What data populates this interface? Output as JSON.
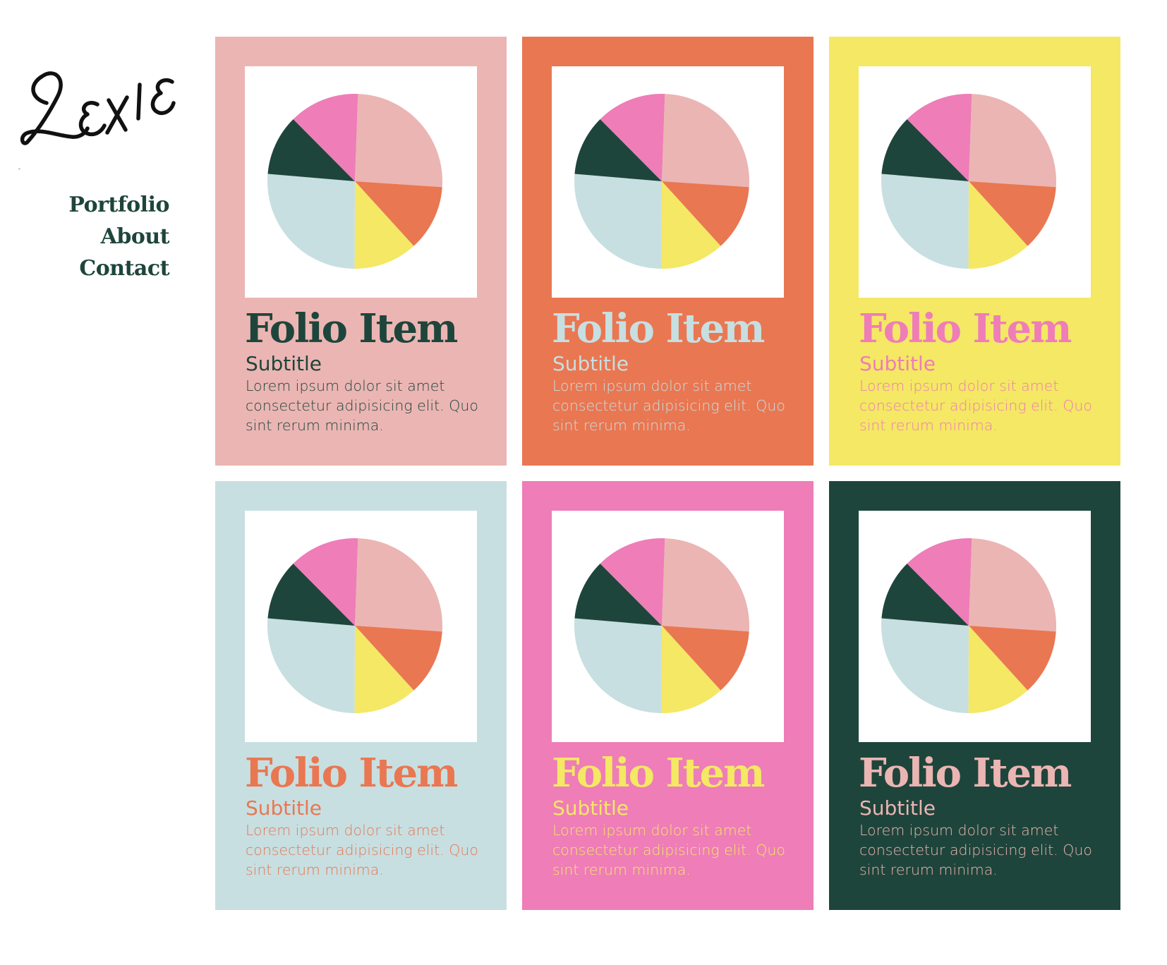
{
  "brand": {
    "logo_text": "Lexie"
  },
  "nav": {
    "items": [
      {
        "label": "Portfolio"
      },
      {
        "label": "About"
      },
      {
        "label": "Contact"
      }
    ]
  },
  "palette": {
    "pink_light": "#EBB5B3",
    "orange": "#E97752",
    "yellow": "#F4E864",
    "light_blue": "#C7DFE1",
    "pink": "#EE7DB8",
    "dark_green": "#1E453B"
  },
  "pie_slices": [
    {
      "color": "#EBB5B3",
      "percent": 25.5
    },
    {
      "color": "#E97752",
      "percent": 12.2
    },
    {
      "color": "#F4E864",
      "percent": 11.8
    },
    {
      "color": "#C7DFE1",
      "percent": 26.3
    },
    {
      "color": "#1E453B",
      "percent": 11.2
    },
    {
      "color": "#EE7DB8",
      "percent": 13.0
    }
  ],
  "cards": [
    {
      "title": "Folio Item",
      "subtitle": "Subtitle",
      "body": "Lorem ipsum dolor sit amet consectetur adipisicing elit. Quo sint rerum minima.",
      "bg": "#EBB5B3",
      "text": "#1E453B"
    },
    {
      "title": "Folio Item",
      "subtitle": "Subtitle",
      "body": "Lorem ipsum dolor sit amet consectetur adipisicing elit. Quo sint rerum minima.",
      "bg": "#E97752",
      "text": "#C7DFE1"
    },
    {
      "title": "Folio Item",
      "subtitle": "Subtitle",
      "body": "Lorem ipsum dolor sit amet consectetur adipisicing elit. Quo sint rerum minima.",
      "bg": "#F4E864",
      "text": "#EE7DB8"
    },
    {
      "title": "Folio Item",
      "subtitle": "Subtitle",
      "body": "Lorem ipsum dolor sit amet consectetur adipisicing elit. Quo sint rerum minima.",
      "bg": "#C7DFE1",
      "text": "#E97752"
    },
    {
      "title": "Folio Item",
      "subtitle": "Subtitle",
      "body": "Lorem ipsum dolor sit amet consectetur adipisicing elit. Quo sint rerum minima.",
      "bg": "#EE7DB8",
      "text": "#F4E864"
    },
    {
      "title": "Folio Item",
      "subtitle": "Subtitle",
      "body": "Lorem ipsum dolor sit amet consectetur adipisicing elit. Quo sint rerum minima.",
      "bg": "#1E453B",
      "text": "#EBB5B3"
    }
  ]
}
